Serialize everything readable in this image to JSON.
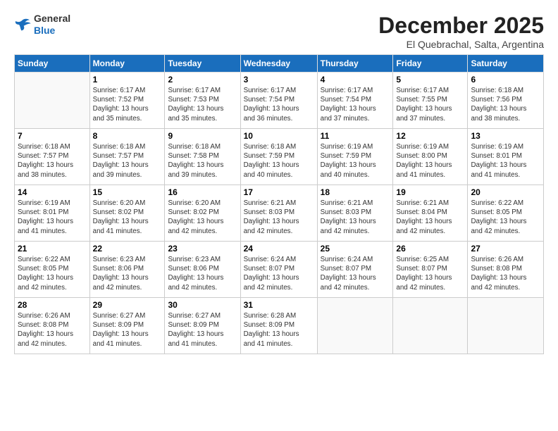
{
  "logo": {
    "general": "General",
    "blue": "Blue"
  },
  "header": {
    "month": "December 2025",
    "location": "El Quebrachal, Salta, Argentina"
  },
  "weekdays": [
    "Sunday",
    "Monday",
    "Tuesday",
    "Wednesday",
    "Thursday",
    "Friday",
    "Saturday"
  ],
  "weeks": [
    [
      {
        "day": "",
        "info": ""
      },
      {
        "day": "1",
        "info": "Sunrise: 6:17 AM\nSunset: 7:52 PM\nDaylight: 13 hours\nand 35 minutes."
      },
      {
        "day": "2",
        "info": "Sunrise: 6:17 AM\nSunset: 7:53 PM\nDaylight: 13 hours\nand 35 minutes."
      },
      {
        "day": "3",
        "info": "Sunrise: 6:17 AM\nSunset: 7:54 PM\nDaylight: 13 hours\nand 36 minutes."
      },
      {
        "day": "4",
        "info": "Sunrise: 6:17 AM\nSunset: 7:54 PM\nDaylight: 13 hours\nand 37 minutes."
      },
      {
        "day": "5",
        "info": "Sunrise: 6:17 AM\nSunset: 7:55 PM\nDaylight: 13 hours\nand 37 minutes."
      },
      {
        "day": "6",
        "info": "Sunrise: 6:18 AM\nSunset: 7:56 PM\nDaylight: 13 hours\nand 38 minutes."
      }
    ],
    [
      {
        "day": "7",
        "info": "Sunrise: 6:18 AM\nSunset: 7:57 PM\nDaylight: 13 hours\nand 38 minutes."
      },
      {
        "day": "8",
        "info": "Sunrise: 6:18 AM\nSunset: 7:57 PM\nDaylight: 13 hours\nand 39 minutes."
      },
      {
        "day": "9",
        "info": "Sunrise: 6:18 AM\nSunset: 7:58 PM\nDaylight: 13 hours\nand 39 minutes."
      },
      {
        "day": "10",
        "info": "Sunrise: 6:18 AM\nSunset: 7:59 PM\nDaylight: 13 hours\nand 40 minutes."
      },
      {
        "day": "11",
        "info": "Sunrise: 6:19 AM\nSunset: 7:59 PM\nDaylight: 13 hours\nand 40 minutes."
      },
      {
        "day": "12",
        "info": "Sunrise: 6:19 AM\nSunset: 8:00 PM\nDaylight: 13 hours\nand 41 minutes."
      },
      {
        "day": "13",
        "info": "Sunrise: 6:19 AM\nSunset: 8:01 PM\nDaylight: 13 hours\nand 41 minutes."
      }
    ],
    [
      {
        "day": "14",
        "info": "Sunrise: 6:19 AM\nSunset: 8:01 PM\nDaylight: 13 hours\nand 41 minutes."
      },
      {
        "day": "15",
        "info": "Sunrise: 6:20 AM\nSunset: 8:02 PM\nDaylight: 13 hours\nand 41 minutes."
      },
      {
        "day": "16",
        "info": "Sunrise: 6:20 AM\nSunset: 8:02 PM\nDaylight: 13 hours\nand 42 minutes."
      },
      {
        "day": "17",
        "info": "Sunrise: 6:21 AM\nSunset: 8:03 PM\nDaylight: 13 hours\nand 42 minutes."
      },
      {
        "day": "18",
        "info": "Sunrise: 6:21 AM\nSunset: 8:03 PM\nDaylight: 13 hours\nand 42 minutes."
      },
      {
        "day": "19",
        "info": "Sunrise: 6:21 AM\nSunset: 8:04 PM\nDaylight: 13 hours\nand 42 minutes."
      },
      {
        "day": "20",
        "info": "Sunrise: 6:22 AM\nSunset: 8:05 PM\nDaylight: 13 hours\nand 42 minutes."
      }
    ],
    [
      {
        "day": "21",
        "info": "Sunrise: 6:22 AM\nSunset: 8:05 PM\nDaylight: 13 hours\nand 42 minutes."
      },
      {
        "day": "22",
        "info": "Sunrise: 6:23 AM\nSunset: 8:06 PM\nDaylight: 13 hours\nand 42 minutes."
      },
      {
        "day": "23",
        "info": "Sunrise: 6:23 AM\nSunset: 8:06 PM\nDaylight: 13 hours\nand 42 minutes."
      },
      {
        "day": "24",
        "info": "Sunrise: 6:24 AM\nSunset: 8:07 PM\nDaylight: 13 hours\nand 42 minutes."
      },
      {
        "day": "25",
        "info": "Sunrise: 6:24 AM\nSunset: 8:07 PM\nDaylight: 13 hours\nand 42 minutes."
      },
      {
        "day": "26",
        "info": "Sunrise: 6:25 AM\nSunset: 8:07 PM\nDaylight: 13 hours\nand 42 minutes."
      },
      {
        "day": "27",
        "info": "Sunrise: 6:26 AM\nSunset: 8:08 PM\nDaylight: 13 hours\nand 42 minutes."
      }
    ],
    [
      {
        "day": "28",
        "info": "Sunrise: 6:26 AM\nSunset: 8:08 PM\nDaylight: 13 hours\nand 42 minutes."
      },
      {
        "day": "29",
        "info": "Sunrise: 6:27 AM\nSunset: 8:09 PM\nDaylight: 13 hours\nand 41 minutes."
      },
      {
        "day": "30",
        "info": "Sunrise: 6:27 AM\nSunset: 8:09 PM\nDaylight: 13 hours\nand 41 minutes."
      },
      {
        "day": "31",
        "info": "Sunrise: 6:28 AM\nSunset: 8:09 PM\nDaylight: 13 hours\nand 41 minutes."
      },
      {
        "day": "",
        "info": ""
      },
      {
        "day": "",
        "info": ""
      },
      {
        "day": "",
        "info": ""
      }
    ]
  ]
}
